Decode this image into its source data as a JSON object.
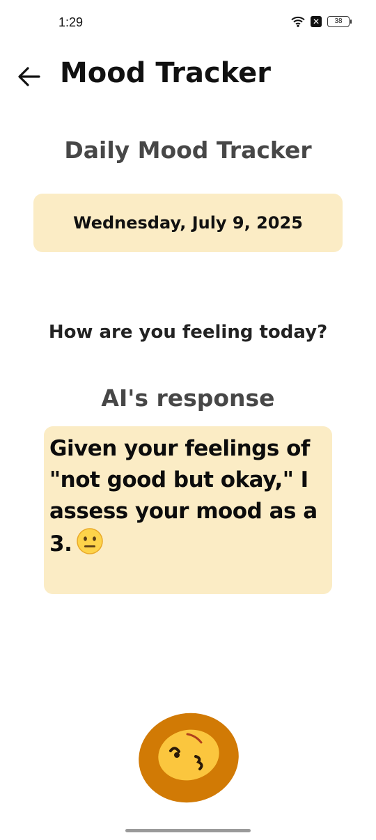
{
  "status_bar": {
    "time": "1:29",
    "battery": "38"
  },
  "app_bar": {
    "title": "Mood Tracker",
    "back_icon": "arrow-left-icon"
  },
  "tracker": {
    "heading": "Daily Mood Tracker",
    "date": "Wednesday, July 9, 2025",
    "question": "How are you feeling today?"
  },
  "ai": {
    "heading": "AI's response",
    "response": "Given your feelings of \"not good but okay,\" I assess your mood as a 3.",
    "emoji": "neutral-face-icon"
  },
  "colors": {
    "card_background": "#fbecc5",
    "blob_outer": "#d17a05",
    "blob_inner": "#fbc63e",
    "heading_text": "#474747"
  }
}
